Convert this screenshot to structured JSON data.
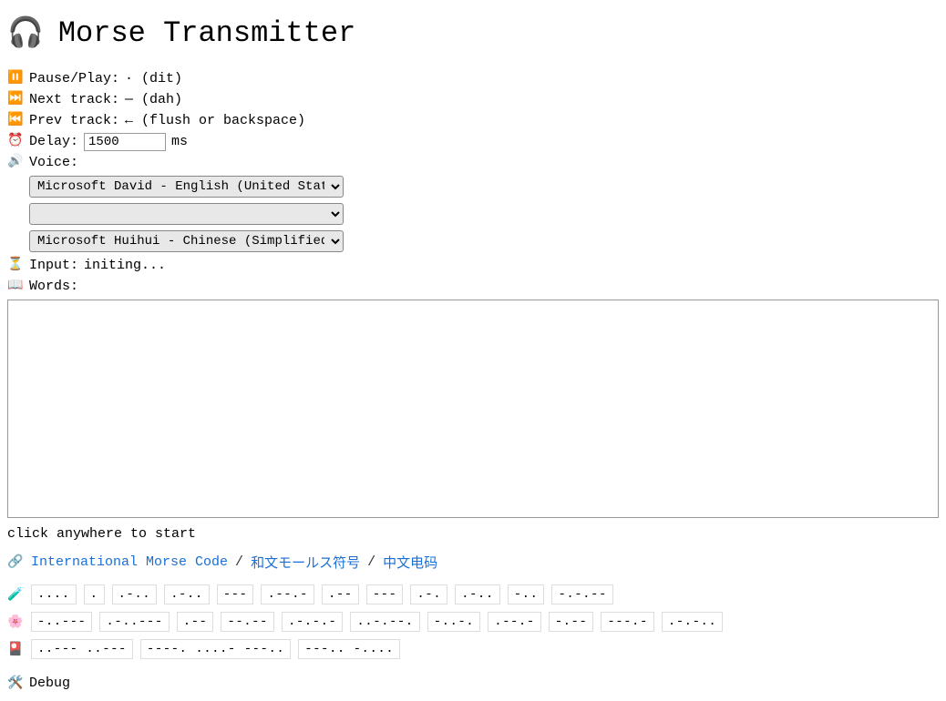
{
  "title": "Morse Transmitter",
  "controls": {
    "pause_play": {
      "label": "Pause/Play:",
      "value": "· (dit)"
    },
    "next_track": {
      "label": "Next track:",
      "value": "— (dah)"
    },
    "prev_track": {
      "label": "Prev track:",
      "value": "← (flush or backspace)"
    },
    "delay": {
      "label": "Delay:",
      "value": "1500",
      "unit": "ms"
    },
    "voice_label": "Voice:",
    "voices": {
      "v1": "Microsoft David - English (United States)",
      "v2": "",
      "v3": "Microsoft Huihui - Chinese (Simplified,"
    },
    "input": {
      "label": "Input:",
      "value": "initing..."
    },
    "words_label": "Words:",
    "words_value": ""
  },
  "start_hint": "click anywhere to start",
  "links": {
    "intl": "International Morse Code",
    "jp": "和文モールス符号",
    "cn": "中文电码"
  },
  "morse": {
    "row1": [
      "....",
      ".",
      ".-..",
      ".-..",
      "---",
      ".--.-",
      ".--",
      "---",
      ".-.",
      ".-..",
      "-..",
      "-.-.--"
    ],
    "row2": [
      "-..---",
      ".-..---",
      ".--",
      "--.--",
      ".-.-.-",
      "..-.--.",
      "-..-.",
      ".--.-",
      "-.--",
      "---.-",
      ".-.-.."
    ],
    "row3": [
      "..--- ..---",
      "----. ....- ---..",
      "---.. -...."
    ]
  },
  "debug_label": "Debug"
}
